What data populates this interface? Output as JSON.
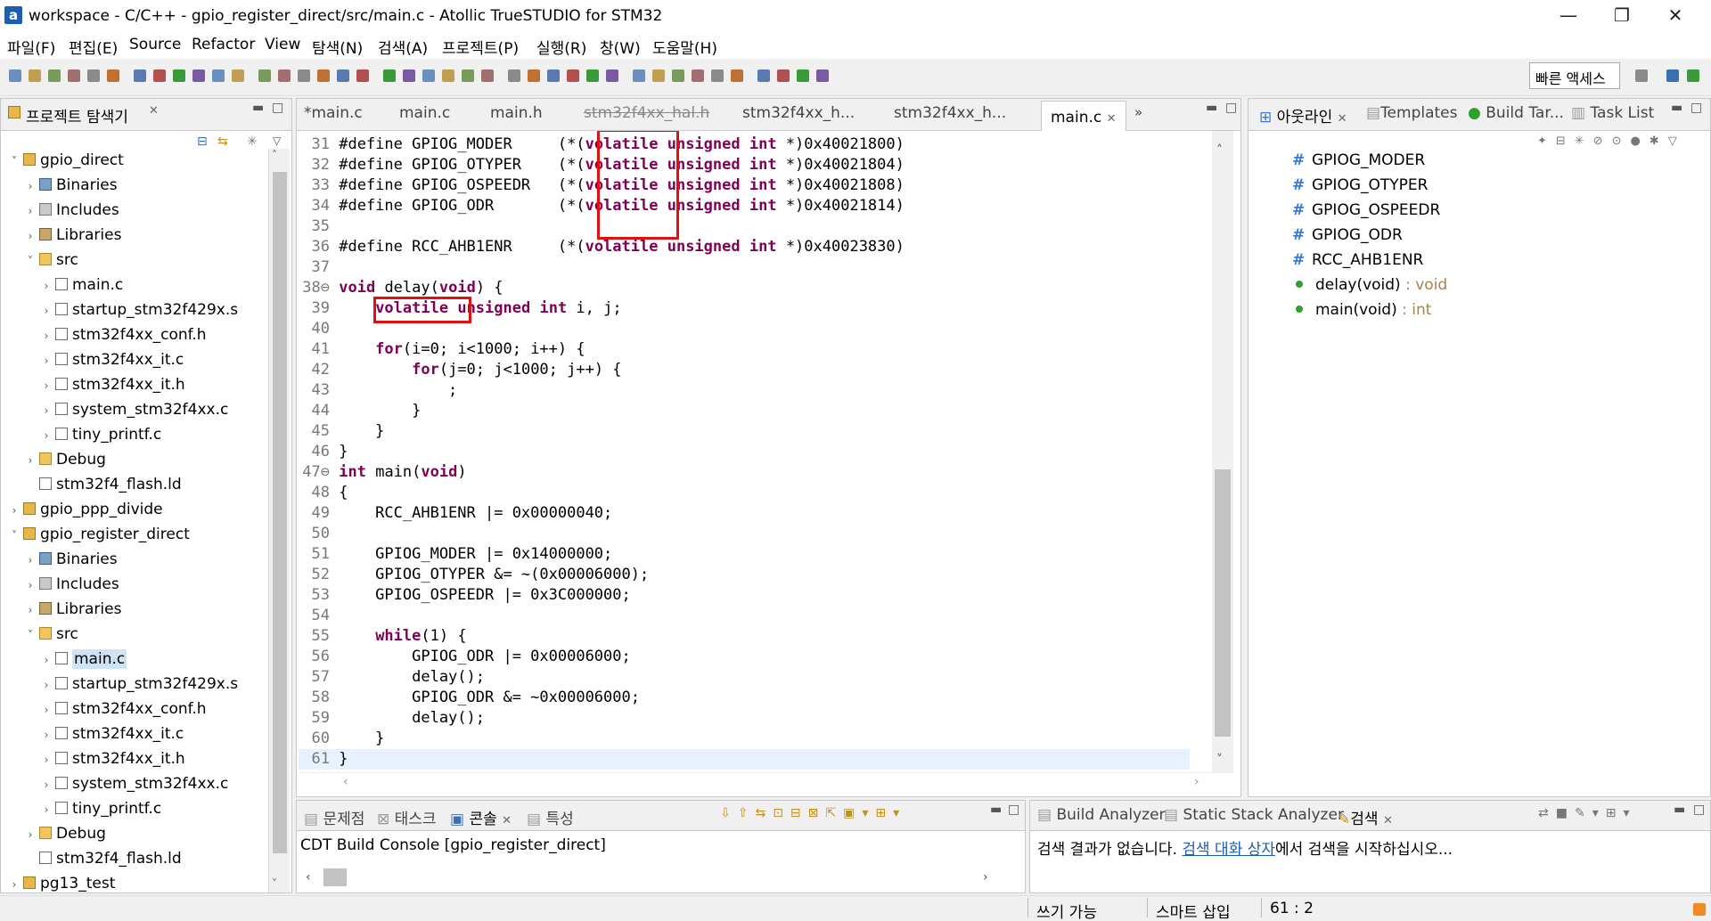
{
  "window": {
    "title": "workspace - C/C++ - gpio_register_direct/src/main.c - Atollic TrueSTUDIO for STM32",
    "app_icon_letter": "a",
    "minimize": "—",
    "maximize": "❐",
    "close": "✕"
  },
  "menu": [
    "파일(F)",
    "편집(E)",
    "Source",
    "Refactor",
    "View",
    "탐색(N)",
    "검색(A)",
    "프로젝트(P)",
    "실행(R)",
    "창(W)",
    "도움말(H)"
  ],
  "quick_access": "빠른 액세스",
  "explorer": {
    "title": "프로젝트 탐색기",
    "items": [
      {
        "label": "gpio_direct",
        "type": "project",
        "depth": 0,
        "arrow": "˅"
      },
      {
        "label": "Binaries",
        "type": "binaries",
        "depth": 1,
        "arrow": "›"
      },
      {
        "label": "Includes",
        "type": "includes",
        "depth": 1,
        "arrow": "›"
      },
      {
        "label": "Libraries",
        "type": "libraries",
        "depth": 1,
        "arrow": "›"
      },
      {
        "label": "src",
        "type": "folder",
        "depth": 1,
        "arrow": "˅"
      },
      {
        "label": "main.c",
        "type": "file",
        "depth": 2,
        "arrow": "›"
      },
      {
        "label": "startup_stm32f429x.s",
        "type": "file",
        "depth": 2,
        "arrow": "›"
      },
      {
        "label": "stm32f4xx_conf.h",
        "type": "file",
        "depth": 2,
        "arrow": "›"
      },
      {
        "label": "stm32f4xx_it.c",
        "type": "file",
        "depth": 2,
        "arrow": "›"
      },
      {
        "label": "stm32f4xx_it.h",
        "type": "file",
        "depth": 2,
        "arrow": "›"
      },
      {
        "label": "system_stm32f4xx.c",
        "type": "file",
        "depth": 2,
        "arrow": "›"
      },
      {
        "label": "tiny_printf.c",
        "type": "file",
        "depth": 2,
        "arrow": "›"
      },
      {
        "label": "Debug",
        "type": "folder",
        "depth": 1,
        "arrow": "›"
      },
      {
        "label": "stm32f4_flash.ld",
        "type": "file",
        "depth": 1,
        "arrow": ""
      },
      {
        "label": "gpio_ppp_divide",
        "type": "project",
        "depth": 0,
        "arrow": "›"
      },
      {
        "label": "gpio_register_direct",
        "type": "project",
        "depth": 0,
        "arrow": "˅"
      },
      {
        "label": "Binaries",
        "type": "binaries",
        "depth": 1,
        "arrow": "›"
      },
      {
        "label": "Includes",
        "type": "includes",
        "depth": 1,
        "arrow": "›"
      },
      {
        "label": "Libraries",
        "type": "libraries",
        "depth": 1,
        "arrow": "›"
      },
      {
        "label": "src",
        "type": "folder",
        "depth": 1,
        "arrow": "˅"
      },
      {
        "label": "main.c",
        "type": "file",
        "depth": 2,
        "arrow": "›",
        "selected": true
      },
      {
        "label": "startup_stm32f429x.s",
        "type": "file",
        "depth": 2,
        "arrow": "›"
      },
      {
        "label": "stm32f4xx_conf.h",
        "type": "file",
        "depth": 2,
        "arrow": "›"
      },
      {
        "label": "stm32f4xx_it.c",
        "type": "file",
        "depth": 2,
        "arrow": "›"
      },
      {
        "label": "stm32f4xx_it.h",
        "type": "file",
        "depth": 2,
        "arrow": "›"
      },
      {
        "label": "system_stm32f4xx.c",
        "type": "file",
        "depth": 2,
        "arrow": "›"
      },
      {
        "label": "tiny_printf.c",
        "type": "file",
        "depth": 2,
        "arrow": "›"
      },
      {
        "label": "Debug",
        "type": "folder",
        "depth": 1,
        "arrow": "›"
      },
      {
        "label": "stm32f4_flash.ld",
        "type": "file",
        "depth": 1,
        "arrow": ""
      },
      {
        "label": "pg13_test",
        "type": "project",
        "depth": 0,
        "arrow": "›"
      }
    ]
  },
  "editor": {
    "tabs": [
      "*main.c",
      "main.c",
      "main.h",
      "stm32f4xx_hal.h",
      "stm32f4xx_h...",
      "stm32f4xx_h...",
      "main.c"
    ],
    "overflow": "»",
    "lines": [
      {
        "n": "31",
        "t": "#define GPIOG_MODER     (*(volatile unsigned int *)0x40021800)"
      },
      {
        "n": "32",
        "t": "#define GPIOG_OTYPER    (*(volatile unsigned int *)0x40021804)"
      },
      {
        "n": "33",
        "t": "#define GPIOG_OSPEEDR   (*(volatile unsigned int *)0x40021808)"
      },
      {
        "n": "34",
        "t": "#define GPIOG_ODR       (*(volatile unsigned int *)0x40021814)"
      },
      {
        "n": "35",
        "t": ""
      },
      {
        "n": "36",
        "t": "#define RCC_AHB1ENR     (*(volatile unsigned int *)0x40023830)"
      },
      {
        "n": "37",
        "t": ""
      },
      {
        "n": "38⊖",
        "t": "void delay(void) {"
      },
      {
        "n": "39",
        "t": "    volatile unsigned int i, j;"
      },
      {
        "n": "40",
        "t": ""
      },
      {
        "n": "41",
        "t": "    for(i=0; i<1000; i++) {"
      },
      {
        "n": "42",
        "t": "        for(j=0; j<1000; j++) {"
      },
      {
        "n": "43",
        "t": "            ;"
      },
      {
        "n": "44",
        "t": "        }"
      },
      {
        "n": "45",
        "t": "    }"
      },
      {
        "n": "46",
        "t": "}"
      },
      {
        "n": "47⊖",
        "t": "int main(void)"
      },
      {
        "n": "48",
        "t": "{"
      },
      {
        "n": "49",
        "t": "    RCC_AHB1ENR |= 0x00000040;"
      },
      {
        "n": "50",
        "t": ""
      },
      {
        "n": "51",
        "t": "    GPIOG_MODER |= 0x14000000;"
      },
      {
        "n": "52",
        "t": "    GPIOG_OTYPER &= ~(0x00006000);"
      },
      {
        "n": "53",
        "t": "    GPIOG_OSPEEDR |= 0x3C000000;"
      },
      {
        "n": "54",
        "t": ""
      },
      {
        "n": "55",
        "t": "    while(1) {"
      },
      {
        "n": "56",
        "t": "        GPIOG_ODR |= 0x00006000;"
      },
      {
        "n": "57",
        "t": "        delay();"
      },
      {
        "n": "58",
        "t": "        GPIOG_ODR &= ~0x00006000;"
      },
      {
        "n": "59",
        "t": "        delay();"
      },
      {
        "n": "60",
        "t": "    }"
      },
      {
        "n": "61",
        "t": "}"
      }
    ],
    "keywords": [
      "volatile",
      "unsigned",
      "int",
      "void",
      "for",
      "while"
    ]
  },
  "outline": {
    "tabs": [
      "아웃라인",
      "Templates",
      "Build Tar...",
      "Task List"
    ],
    "items": [
      {
        "kind": "macro",
        "name": "GPIOG_MODER",
        "type": ""
      },
      {
        "kind": "macro",
        "name": "GPIOG_OTYPER",
        "type": ""
      },
      {
        "kind": "macro",
        "name": "GPIOG_OSPEEDR",
        "type": ""
      },
      {
        "kind": "macro",
        "name": "GPIOG_ODR",
        "type": ""
      },
      {
        "kind": "macro",
        "name": "RCC_AHB1ENR",
        "type": ""
      },
      {
        "kind": "function",
        "name": "delay(void)",
        "type": " : void"
      },
      {
        "kind": "function",
        "name": "main(void)",
        "type": " : int"
      }
    ]
  },
  "console": {
    "tabs": [
      "문제점",
      "태스크",
      "콘솔",
      "특성"
    ],
    "header": "CDT Build Console [gpio_register_direct]"
  },
  "search": {
    "tabs": [
      "Build Analyzer",
      "Static Stack Analyzer",
      "검색"
    ],
    "message_prefix": "검색 결과가 없습니다. ",
    "message_link": "검색 대화 상자",
    "message_suffix": "에서 검색을 시작하십시오..."
  },
  "status": {
    "mode": "쓰기 가능",
    "insert": "스마트 삽입",
    "position": "61 : 2"
  },
  "colors": {
    "keyword": "#7f0055",
    "highlight_box": "#e01010",
    "selection": "#cfe3f7"
  }
}
